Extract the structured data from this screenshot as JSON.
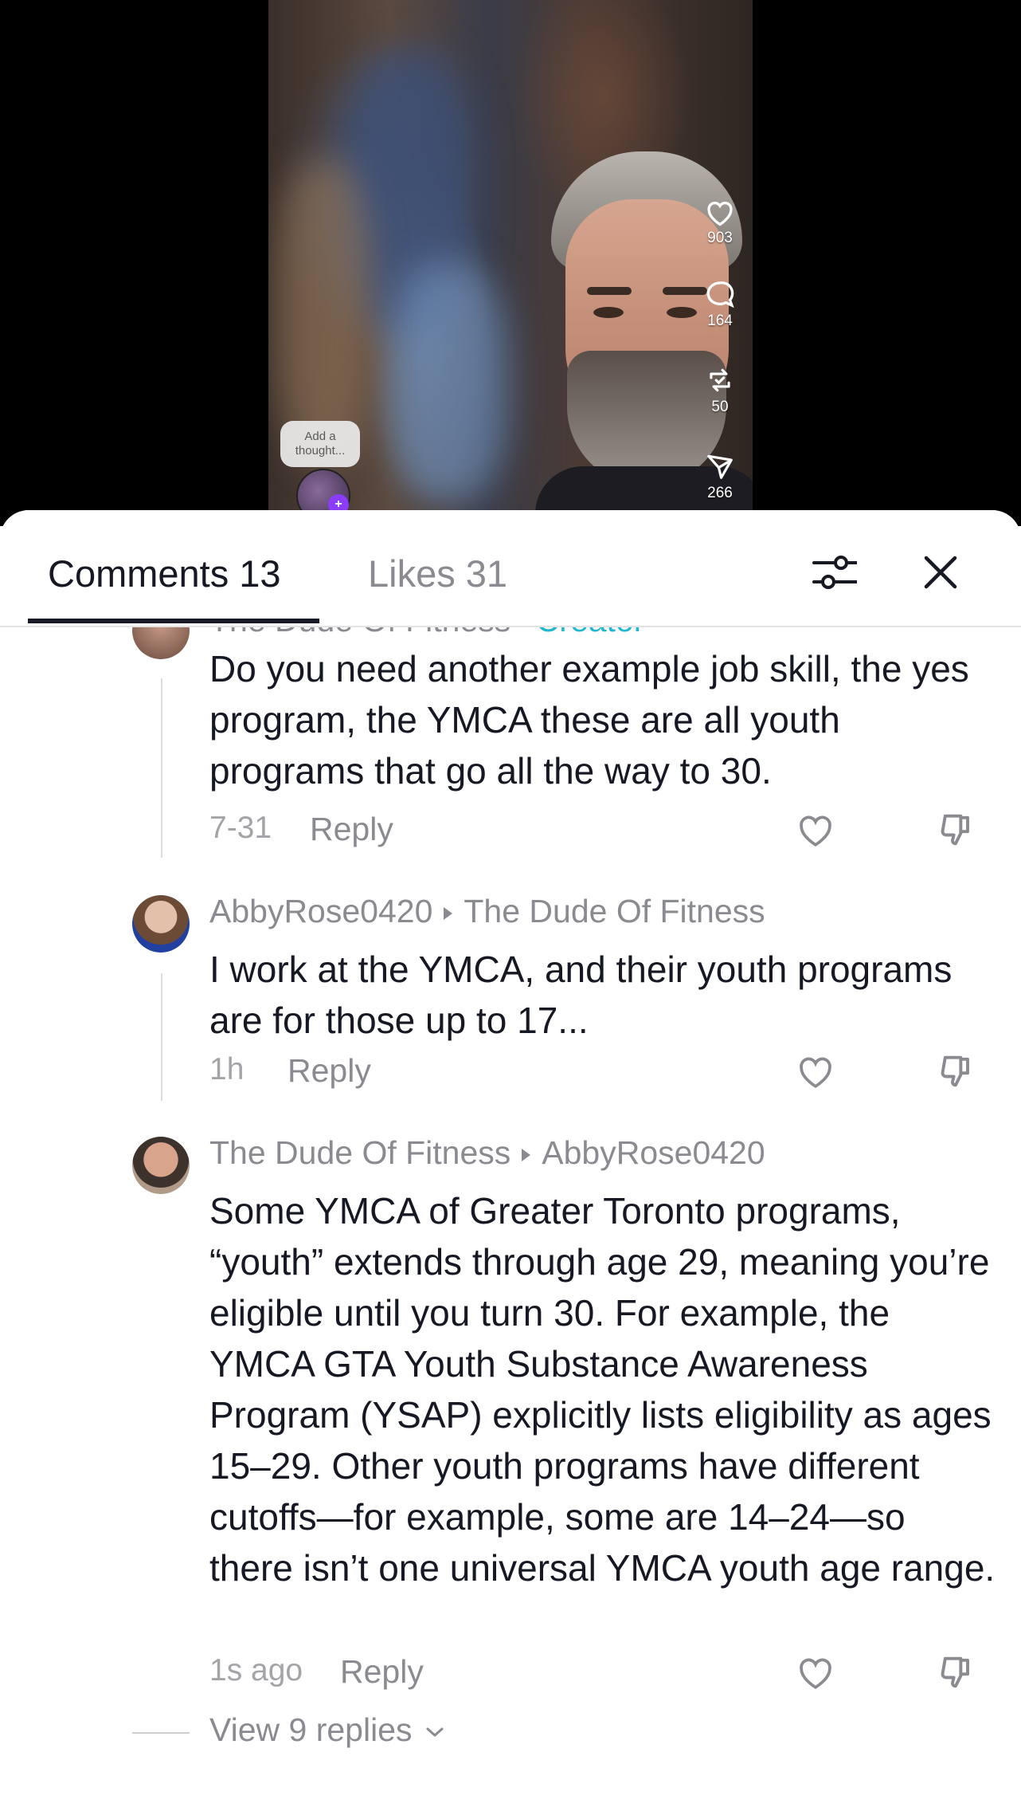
{
  "video": {
    "actions": {
      "likes_count": "903",
      "comments_count": "164",
      "reposts_count": "50",
      "shares_count": "266"
    },
    "thought_bubble": "Add a thought..."
  },
  "sheet": {
    "tabs": {
      "comments": "Comments 13",
      "likes": "Likes 31"
    },
    "icons": [
      "filter-sliders-icon",
      "close-icon"
    ]
  },
  "comments": [
    {
      "username": "The Dude Of Fitness",
      "tag": "Creator",
      "text": "Do you need another example job skill, the yes program, the YMCA these are all youth programs that go all the way to 30.",
      "time": "7-31",
      "reply_label": "Reply"
    },
    {
      "username": "AbbyRose0420",
      "reply_to": "The Dude Of Fitness",
      "text": "I work at the YMCA, and their youth programs are for those up to 17...",
      "time": "1h",
      "reply_label": "Reply"
    },
    {
      "username": "The Dude Of Fitness",
      "reply_to": "AbbyRose0420",
      "text": "Some YMCA of Greater Toronto programs, “youth” extends through age 29, meaning you’re eligible until you turn 30. For example, the YMCA GTA Youth Substance Awareness Program (YSAP) explicitly lists eligibility as ages 15–29. Other youth programs have different cutoffs—for example, some are 14–24—so there isn’t one universal YMCA youth age range.",
      "time": "1s ago",
      "reply_label": "Reply"
    }
  ],
  "view_replies": "View 9 replies",
  "colors": {
    "primary_text": "#161823",
    "secondary_text": "#8a8b91",
    "creator_accent": "#20b8d0",
    "badge_purple": "#8b3cff"
  }
}
